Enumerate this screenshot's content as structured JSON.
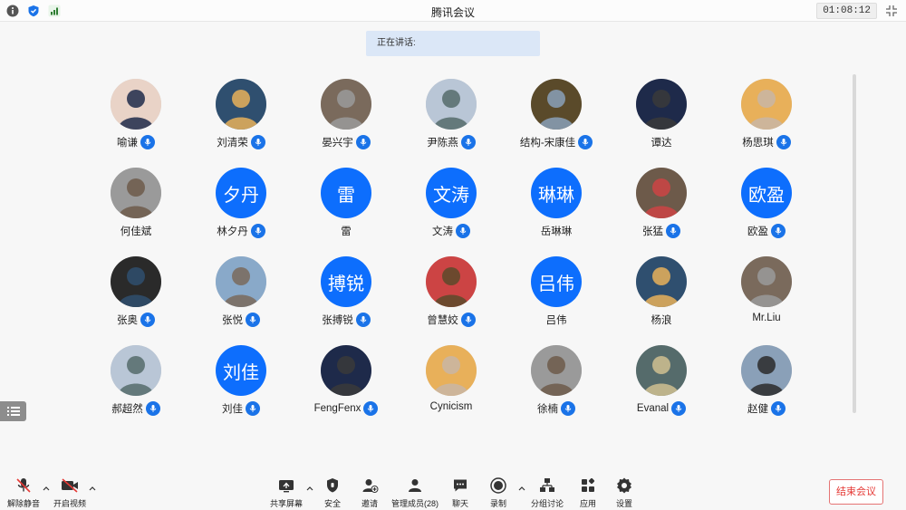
{
  "window": {
    "title": "腾讯会议",
    "timer": "01:08:12"
  },
  "speaking": {
    "label": "正在讲话:"
  },
  "participants": [
    {
      "name": "喻谦",
      "avatar_text": "",
      "mic": true
    },
    {
      "name": "刘清荣",
      "avatar_text": "",
      "mic": true
    },
    {
      "name": "晏兴宇",
      "avatar_text": "",
      "mic": true
    },
    {
      "name": "尹陈燕",
      "avatar_text": "",
      "mic": true
    },
    {
      "name": "结构-宋康佳",
      "avatar_text": "",
      "mic": true
    },
    {
      "name": "谭达",
      "avatar_text": "",
      "mic": false
    },
    {
      "name": "杨思琪",
      "avatar_text": "",
      "mic": true
    },
    {
      "name": "何佳斌",
      "avatar_text": "",
      "mic": false
    },
    {
      "name": "林夕丹",
      "avatar_text": "夕丹",
      "mic": true
    },
    {
      "name": "雷",
      "avatar_text": "雷",
      "mic": false
    },
    {
      "name": "文涛",
      "avatar_text": "文涛",
      "mic": true
    },
    {
      "name": "岳琳琳",
      "avatar_text": "琳琳",
      "mic": false
    },
    {
      "name": "张猛",
      "avatar_text": "",
      "mic": true
    },
    {
      "name": "欧盈",
      "avatar_text": "欧盈",
      "mic": true
    },
    {
      "name": "张奥",
      "avatar_text": "",
      "mic": true
    },
    {
      "name": "张悦",
      "avatar_text": "",
      "mic": true
    },
    {
      "name": "张搏锐",
      "avatar_text": "搏锐",
      "mic": true
    },
    {
      "name": "曾慧姣",
      "avatar_text": "",
      "mic": true
    },
    {
      "name": "吕伟",
      "avatar_text": "吕伟",
      "mic": false
    },
    {
      "name": "杨浪",
      "avatar_text": "",
      "mic": false
    },
    {
      "name": "Mr.Liu",
      "avatar_text": "",
      "mic": false
    },
    {
      "name": "郝超然",
      "avatar_text": "",
      "mic": true
    },
    {
      "name": "刘佳",
      "avatar_text": "刘佳",
      "mic": true
    },
    {
      "name": "FengFenx",
      "avatar_text": "",
      "mic": true
    },
    {
      "name": "Cynicism",
      "avatar_text": "",
      "mic": false
    },
    {
      "name": "徐楠",
      "avatar_text": "",
      "mic": true
    },
    {
      "name": "Evanal",
      "avatar_text": "",
      "mic": true
    },
    {
      "name": "赵健",
      "avatar_text": "",
      "mic": true
    }
  ],
  "toolbar": {
    "unmute": "解除静音",
    "start_video": "开启视频",
    "share_screen": "共享屏幕",
    "security": "安全",
    "invite": "邀请",
    "manage_members": "管理成员(28)",
    "chat": "聊天",
    "record": "录制",
    "breakout": "分组讨论",
    "apps": "应用",
    "settings": "设置",
    "end_meeting": "结束会议"
  },
  "colors": {
    "accent": "#0d6efd",
    "mic_badge": "#1a73e8",
    "speaking_bg": "#dbe7f7",
    "end_red": "#e53935"
  }
}
